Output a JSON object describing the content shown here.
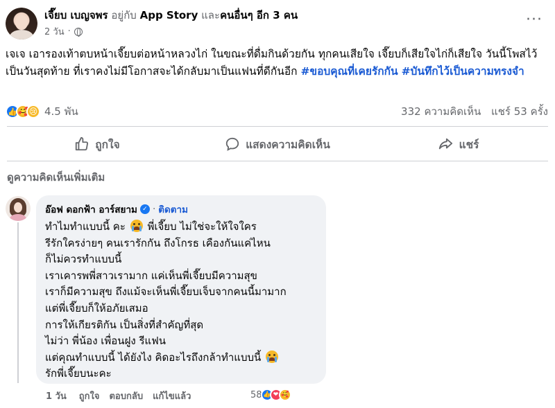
{
  "post": {
    "author": "เจี๊ยบ เบญจพร",
    "with_prefix": "อยู่กับ",
    "with_page": "App Story",
    "and_text": "และ",
    "others": "คนอื่นๆ อีก 3 คน",
    "time": "2 วัน",
    "dot": "·",
    "body": "เจเจ เอารองเท้าตบหน้าเจี๊ยบต่อหน้าหลวงไก่ ในขณะที่ดื่มกินด้วยกัน ทุกคนเสียใจ เจี๊ยบก็เสียใจไก่ก็เสียใจ วันนี้โพสไว้เป็นวันสุดท้าย ที่เราคงไม่มีโอกาสจะได้กลับมาเป็นแฟนที่ดีกันอีก",
    "hashtag1": "#ขอบคุณที่เคยรักกัน",
    "hashtag2": "#บันทึกไว้เป็นความทรงจำ"
  },
  "stats": {
    "reaction_count": "4.5 พัน",
    "comments": "332 ความคิดเห็น",
    "shares": "แชร์ 53 ครั้ง"
  },
  "actions": {
    "like": "ถูกใจ",
    "comment": "แสดงความคิดเห็น",
    "share": "แชร์"
  },
  "more_comments": "ดูความคิดเห็นเพิ่มเติม",
  "comment": {
    "author": "อ๊อฟ ดอกฟ้า อาร์สยาม",
    "follow": "ติดตาม",
    "dot": "·",
    "lines": [
      "ทำไมทำแบบนี้ คะ",
      "พี่เจี๊ยบ ไม่ใช่จะให้ใจใคร",
      "รีรักใครง่ายๆ คนเรารักกัน ถึงโกรธ เคืองกันแค่ไหน",
      "ก็ไม่ควรทำแบบนี้",
      "เราเคารพพี่สาวเรามาก แค่เห็นพี่เจี๊ยบมีความสุข",
      "เราก็มีความสุข ถึงแม้จะเห็นพี่เจี๊ยบเจ็บจากคนนี้มามาก",
      "แต่พี่เจี๊ยบก็ให้อภัยเสมอ",
      "การให้เกียรติกัน เป็นสิ่งที่สำคัญที่สุด",
      "ไม่ว่า พี่น้อง เพื่อนฝูง รีแฟน",
      "แต่คุณทำแบบนี้ ได้ยังไง คิดอะไรถึงกล้าทำแบบนี้",
      "รักพี่เจี๊ยบนะคะ"
    ],
    "time": "1 วัน",
    "like": "ถูกใจ",
    "reply": "ตอบกลับ",
    "edited": "แก้ไขแล้ว",
    "reaction_count": "58"
  }
}
